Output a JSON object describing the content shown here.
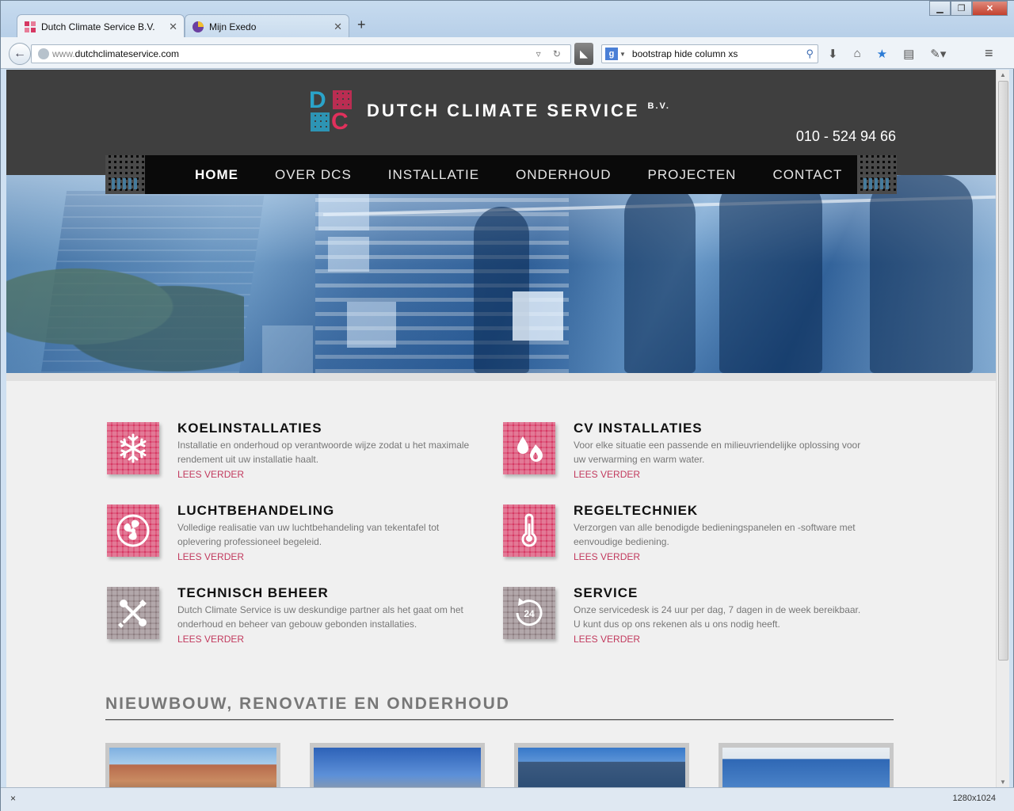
{
  "browser": {
    "tabs": [
      {
        "title": "Dutch Climate Service B.V.",
        "active": true
      },
      {
        "title": "Mijn Exedo",
        "active": false
      }
    ],
    "new_tab_label": "+",
    "url_scheme": "www.",
    "url_host": "dutchclimateservice.com",
    "search_engine_letter": "g",
    "search_query": "bootstrap hide column xs",
    "status_close": "×",
    "status_dimensions": "1280x1024"
  },
  "site": {
    "brand_name": "DUTCH CLIMATE SERVICE",
    "brand_suffix": "B.V.",
    "logo_letter_d": "D",
    "logo_letter_c": "C",
    "phone": "010 - 524 94 66",
    "nav": [
      "HOME",
      "OVER DCS",
      "INSTALLATIE",
      "ONDERHOUD",
      "PROJECTEN",
      "CONTACT"
    ],
    "nav_active_index": 0,
    "services": [
      {
        "title": "KOELINSTALLATIES",
        "text": "Installatie en onderhoud op verantwoorde wijze zodat u het maximale rendement uit uw installatie haalt.",
        "link": "LEES VERDER",
        "icon": "snowflake-icon",
        "color": "pink"
      },
      {
        "title": "CV INSTALLATIES",
        "text": "Voor elke situatie een passende en milieuvriendelijke oplossing voor uw verwarming en warm water.",
        "link": "LEES VERDER",
        "icon": "flame-drop-icon",
        "color": "pink"
      },
      {
        "title": "LUCHTBEHANDELING",
        "text": "Volledige realisatie van uw luchtbehandeling van tekentafel tot oplevering professioneel begeleid.",
        "link": "LEES VERDER",
        "icon": "fan-icon",
        "color": "pink"
      },
      {
        "title": "REGELTECHNIEK",
        "text": "Verzorgen van alle benodigde bedieningspanelen en -software met eenvoudige bediening.",
        "link": "LEES VERDER",
        "icon": "thermometer-icon",
        "color": "pink"
      },
      {
        "title": "TECHNISCH BEHEER",
        "text": "Dutch Climate Service is uw deskundige partner als het gaat om het onderhoud en beheer van gebouw gebonden installaties.",
        "link": "LEES VERDER",
        "icon": "tools-icon",
        "color": "grey"
      },
      {
        "title": "SERVICE",
        "text": "Onze servicedesk is 24 uur per dag, 7 dagen in de week bereikbaar. U kunt dus op ons rekenen als u ons nodig heeft.",
        "link": "LEES VERDER",
        "icon": "24h-icon",
        "color": "grey"
      }
    ],
    "section_title": "NIEUWBOUW, RENOVATIE EN ONDERHOUD"
  },
  "colors": {
    "accent_pink": "#d63863",
    "link_pink": "#c23a5e",
    "icon_grey": "#8c7d80",
    "header_bg": "#3f3f3f",
    "nav_bg": "#0a0a0a"
  }
}
